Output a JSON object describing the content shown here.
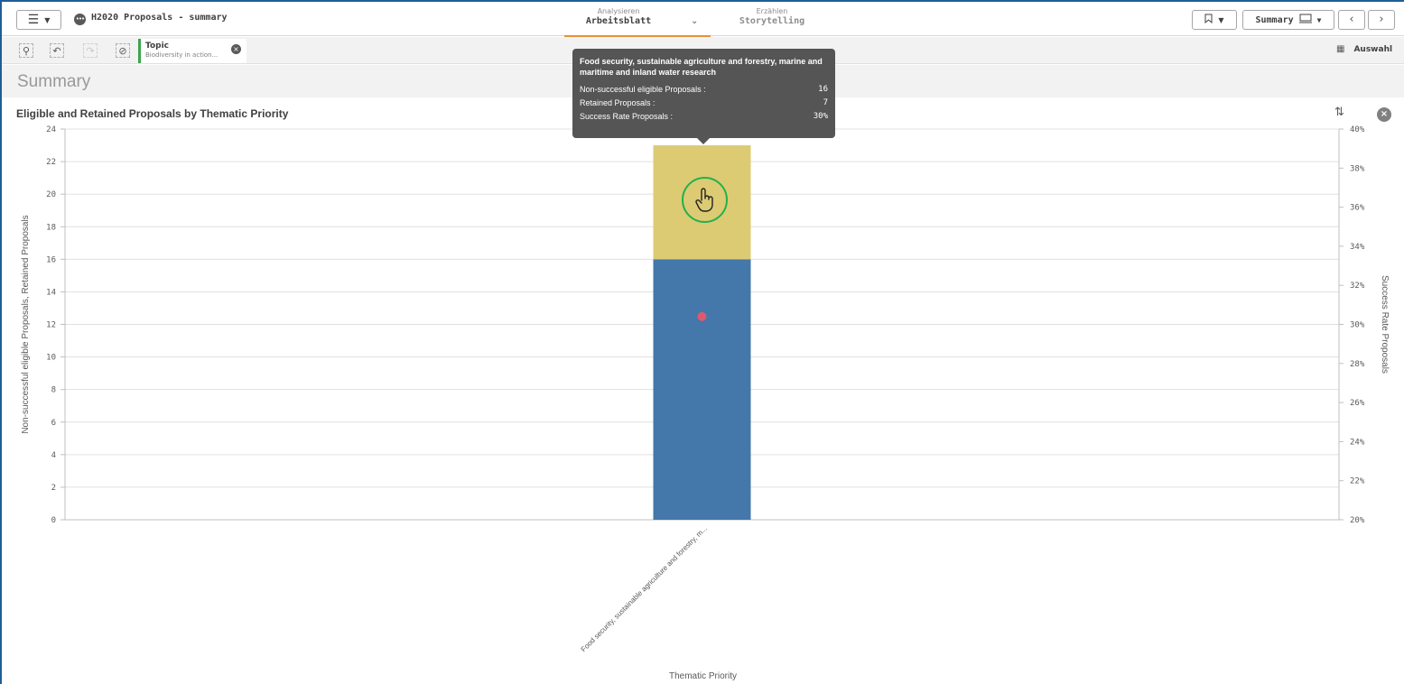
{
  "app": {
    "title": "H2020 Proposals - summary"
  },
  "nav": {
    "analyze_small": "Analysieren",
    "analyze_big": "Arbeitsblatt",
    "story_small": "Erzählen",
    "story_big": "Storytelling"
  },
  "toolbar": {
    "sheet_label": "Summary"
  },
  "selection": {
    "field": "Topic",
    "value": "Biodiversity in action...",
    "panel_label": "Auswahl"
  },
  "sheet": {
    "title": "Summary"
  },
  "icons": {
    "menu": "hamburger-icon",
    "bookmark": "bookmark-icon",
    "sheet": "sheet-icon",
    "cursor": "pointer-hand-icon"
  },
  "colors": {
    "non_successful": "#4477aa",
    "retained": "#dccb73",
    "success_rate": "#dc5a6e",
    "accent": "#e69138"
  },
  "chart_data": {
    "type": "bar",
    "title": "Eligible and Retained Proposals by Thematic Priority",
    "xlabel": "Thematic Priority",
    "ylabel": "Non-successful eligible Proposals, Retained Proposals",
    "y2label": "Success Rate Proposals",
    "categories": [
      "Food security, sustainable agriculture and forestry, m..."
    ],
    "series": [
      {
        "name": "Non-successful eligible Proposals",
        "values": [
          16
        ]
      },
      {
        "name": "Retained Proposals",
        "values": [
          7
        ]
      },
      {
        "name": "Success Rate Proposals",
        "values": [
          0.304
        ],
        "axis": "right",
        "marker": "point"
      }
    ],
    "ylim": [
      0,
      24
    ],
    "y2lim": [
      0.2,
      0.4
    ],
    "yticks": [
      "0",
      "2",
      "4",
      "6",
      "8",
      "10",
      "12",
      "14",
      "16",
      "18",
      "20",
      "22",
      "24"
    ],
    "y2ticks": [
      "20%",
      "22%",
      "24%",
      "26%",
      "28%",
      "30%",
      "32%",
      "34%",
      "36%",
      "38%",
      "40%"
    ],
    "grid": true,
    "stacked": true,
    "tooltip": {
      "title": "Food security, sustainable agriculture and forestry, marine and maritime and inland water research",
      "rows": [
        {
          "label": "Non-successful eligible Proposals :",
          "value": "16"
        },
        {
          "label": "Retained Proposals :",
          "value": "7"
        },
        {
          "label": "Success Rate Proposals :",
          "value": "30%"
        }
      ]
    }
  }
}
